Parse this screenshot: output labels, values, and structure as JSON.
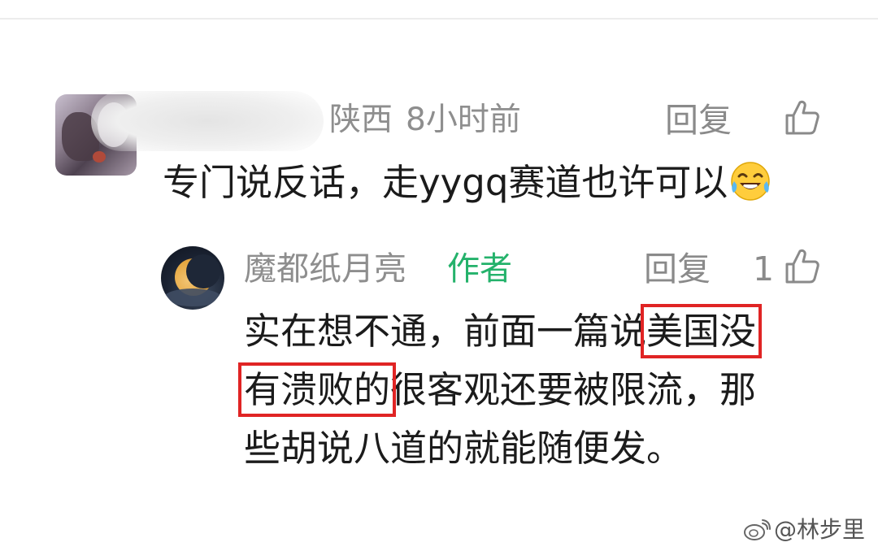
{
  "comment": {
    "location": "陕西",
    "time": "8小时前",
    "reply_label": "回复",
    "text": "专门说反话，走yygq赛道也许可以",
    "emoji": "laughing-tears-emoji"
  },
  "reply": {
    "username": "魔都纸月亮",
    "author_tag": "作者",
    "reply_label": "回复",
    "like_count": "1",
    "line1_plain": "实在想不通，前面一篇说",
    "line1_highlight": "美国没",
    "line2_highlight": "有溃败的",
    "line2_plain": "很客观还要被限流，那",
    "line3": "些胡说八道的就能随便发。",
    "highlight_color": "#e02424"
  },
  "watermark": {
    "text": "@林步里"
  },
  "colors": {
    "meta_gray": "#8e8e8e",
    "author_green": "#24b26b",
    "text_dark": "#1b1b1b"
  }
}
